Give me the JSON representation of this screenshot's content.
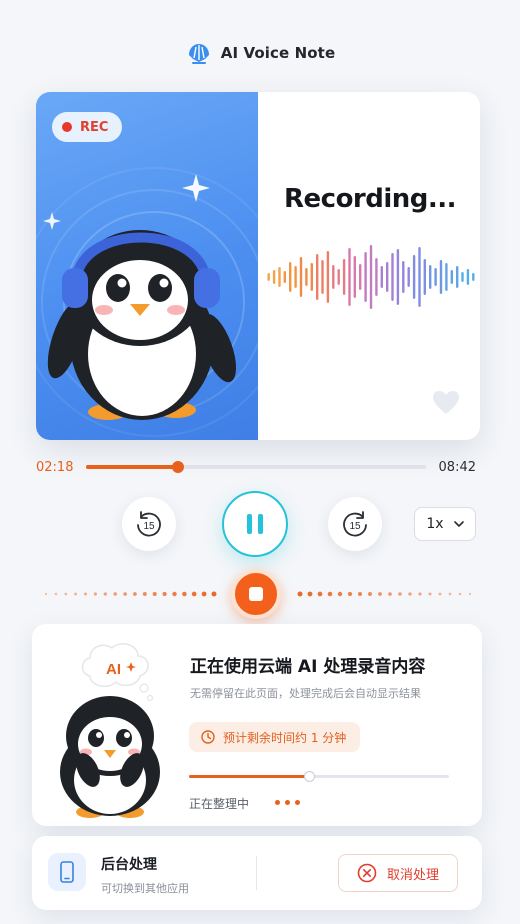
{
  "header": {
    "title": "AI Voice Note",
    "logo_icon": "shell-logo-icon"
  },
  "recording": {
    "badge": "REC",
    "status": "Recording...",
    "current_time": "02:18",
    "total_time": "08:42",
    "progress": 0.27
  },
  "controls": {
    "rewind_seconds": "15",
    "forward_seconds": "15",
    "speed": "1x"
  },
  "ai_panel": {
    "bubble": "AI",
    "title": "正在使用云端 AI 处理录音内容",
    "subtitle": "无需停留在此页面，处理完成后会自动显示结果",
    "eta": "预计剩余时间约 1 分钟",
    "progress": 0.46,
    "status": "正在整理中"
  },
  "bottom": {
    "title": "后台处理",
    "subtitle": "可切换到其他应用",
    "cancel_label": "取消处理"
  },
  "colors": {
    "accent": "#e8611c",
    "pause_ring": "#25c3d9",
    "card_blue": "#4b8ef0",
    "danger": "#e23d2c"
  }
}
